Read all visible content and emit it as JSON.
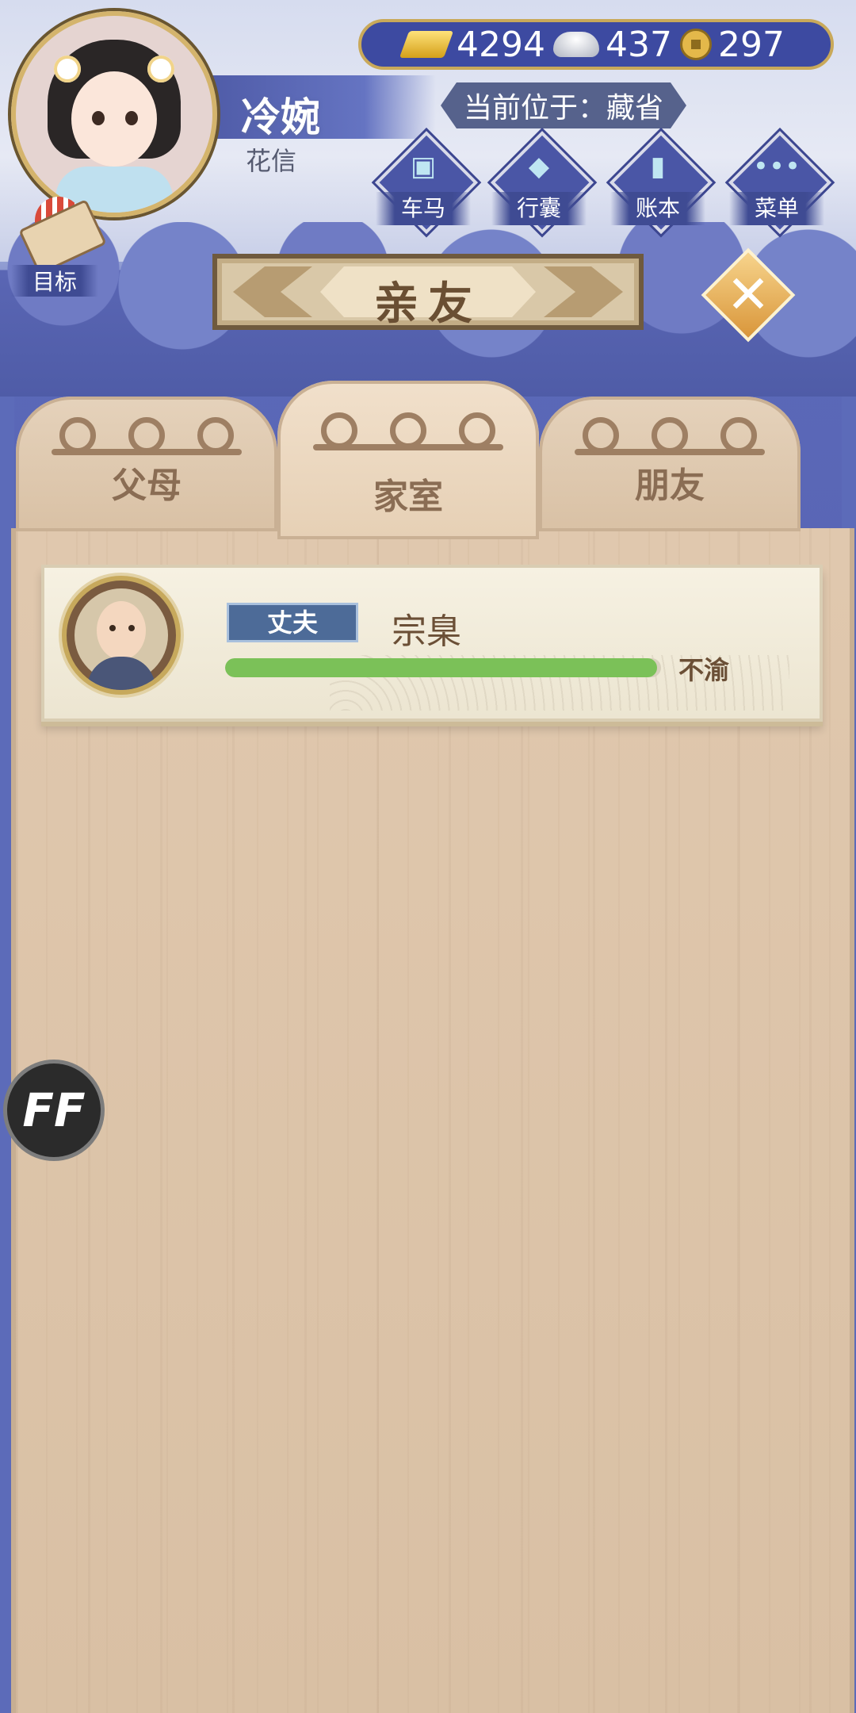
{
  "player": {
    "name": "冷婉",
    "subtitle": "花信"
  },
  "currency": {
    "gold": "4294",
    "silver": "437",
    "coin": "297"
  },
  "location": "当前位于：藏省",
  "menu": [
    {
      "label": "车马",
      "icon": "carriage-icon"
    },
    {
      "label": "行囊",
      "icon": "bag-icon"
    },
    {
      "label": "账本",
      "icon": "ledger-icon"
    },
    {
      "label": "菜单",
      "icon": "more-icon"
    }
  ],
  "goal_label": "目标",
  "title": "亲友",
  "tabs": [
    {
      "label": "父母",
      "active": false
    },
    {
      "label": "家室",
      "active": true
    },
    {
      "label": "朋友",
      "active": false
    }
  ],
  "relatives": [
    {
      "relation": "丈夫",
      "name": "宗臬",
      "status": "不渝",
      "affection": 0.99
    }
  ],
  "ff_label": "FF",
  "colors": {
    "bar_fill": "#7bc158",
    "badge": "#4d6b98",
    "panel": "#d9c0a4"
  }
}
